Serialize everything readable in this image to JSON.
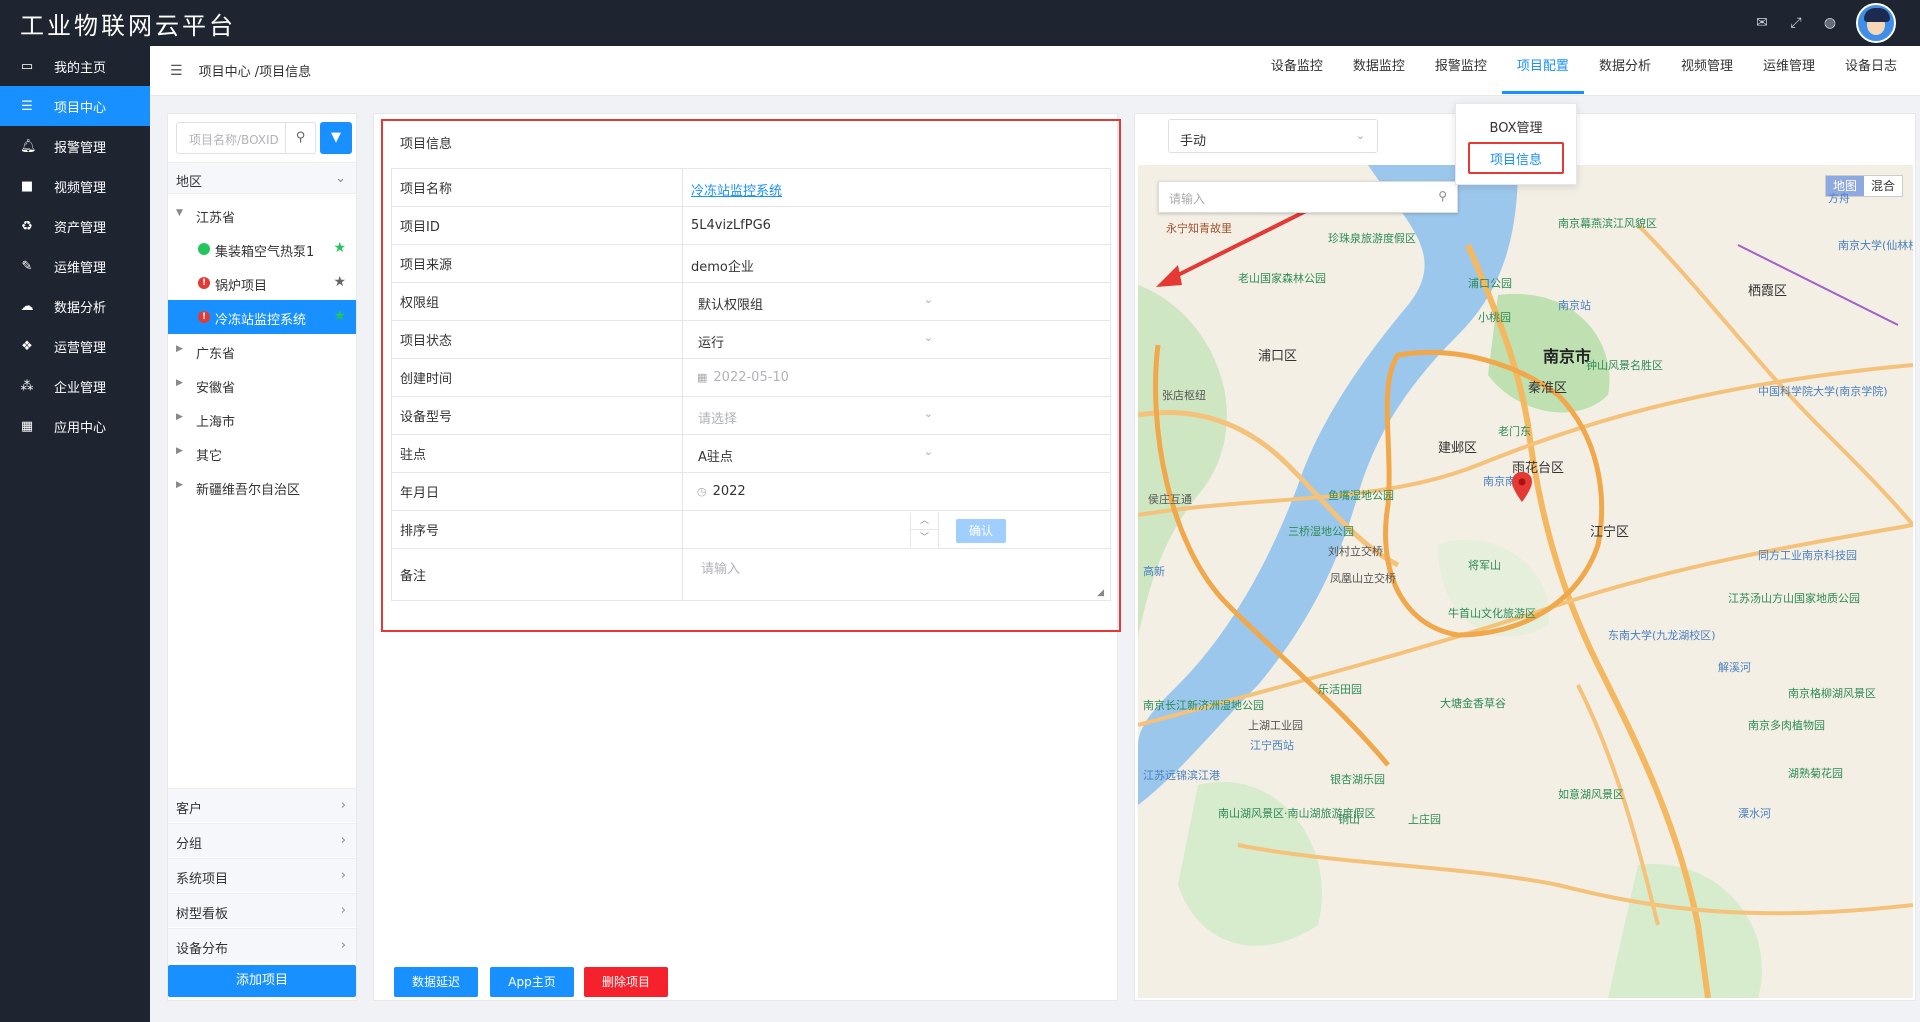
{
  "app": {
    "title": "工业物联网云平台"
  },
  "leftnav": {
    "items": [
      {
        "label": "我的主页",
        "icon": "laptop-icon",
        "active": false
      },
      {
        "label": "项目中心",
        "icon": "list-icon",
        "active": true
      },
      {
        "label": "报警管理",
        "icon": "bell-icon",
        "active": false
      },
      {
        "label": "视频管理",
        "icon": "video-icon",
        "active": false
      },
      {
        "label": "资产管理",
        "icon": "recycle-icon",
        "active": false
      },
      {
        "label": "运维管理",
        "icon": "wrench-icon",
        "active": false
      },
      {
        "label": "数据分析",
        "icon": "cloud-icon",
        "active": false
      },
      {
        "label": "运营管理",
        "icon": "cubes-icon",
        "active": false
      },
      {
        "label": "企业管理",
        "icon": "sitemap-icon",
        "active": false
      },
      {
        "label": "应用中心",
        "icon": "grid-icon",
        "active": false
      }
    ]
  },
  "header": {
    "breadcrumb": "项目中心 /项目信息",
    "tabs": [
      "设备监控",
      "数据监控",
      "报警监控",
      "项目配置",
      "数据分析",
      "视频管理",
      "运维管理",
      "设备日志"
    ],
    "active_tab": "项目配置"
  },
  "dropdown": {
    "items": [
      "BOX管理",
      "项目信息"
    ],
    "selected": "项目信息"
  },
  "tree": {
    "search_placeholder": "项目名称/BOXID",
    "region_header": "地区",
    "provinces": [
      "江苏省",
      "广东省",
      "安徽省",
      "上海市",
      "其它",
      "新疆维吾尔自治区"
    ],
    "projects": [
      {
        "name": "集装箱空气热泵1",
        "status": "online",
        "starred": true
      },
      {
        "name": "锅炉项目",
        "status": "alarm",
        "starred": false
      },
      {
        "name": "冷冻站监控系统",
        "status": "alarm",
        "starred": true,
        "selected": true
      }
    ],
    "sections": [
      "客户",
      "分组",
      "系统项目",
      "树型看板",
      "设备分布"
    ],
    "add_button": "添加项目"
  },
  "form": {
    "title": "项目信息",
    "labels": {
      "name": "项目名称",
      "id": "项目ID",
      "source": "项目来源",
      "perm": "权限组",
      "status": "项目状态",
      "created": "创建时间",
      "model": "设备型号",
      "site": "驻点",
      "year": "年月日",
      "order": "排序号",
      "remark": "备注"
    },
    "values": {
      "name": "冷冻站监控系统",
      "id": "5L4vizLfPG6",
      "source": "demo企业",
      "perm": "默认权限组",
      "status": "运行",
      "created": "2022-05-10",
      "model_placeholder": "请选择",
      "site": "A驻点",
      "year": "2022",
      "remark_placeholder": "请输入"
    },
    "confirm_label": "确认",
    "buttons": {
      "delay": "数据延迟",
      "app": "App主页",
      "delete": "删除项目"
    }
  },
  "map": {
    "mode": "手动",
    "search_placeholder": "请输入",
    "type_buttons": [
      "地图",
      "混合"
    ],
    "labels": {
      "city": "南京市",
      "qinhuai": "秦淮区",
      "pukou": "浦口区",
      "jianye": "建邺区",
      "yuhuatai": "雨花台区",
      "jiangning": "江宁区",
      "qixia": "栖霞区",
      "zhongshan": "钟山风景名胜区",
      "laomendong": "老门东",
      "sanqiao": "三桥湿地公园",
      "yuzui": "鱼嘴湿地公园",
      "niushou": "牛首山文化旅游区",
      "jiangjunshan": "将军山",
      "jiangsu_tangshan": "江苏汤山方山国家地质公园",
      "laoshan": "老山国家森林公园",
      "zhenzhuquan": "珍珠泉旅游度假区",
      "muyan": "南京幕燕滨江风貌区",
      "nanjing_station": "南京站",
      "xiaotaoyuan": "小桃园",
      "pukou_park": "浦口公园",
      "zhangdian": "张店枢纽",
      "houzhuang": "侯庄互通",
      "liucun": "刘村立交桥",
      "fenghuangshan": "凤凰山立交桥",
      "letian": "乐活田园",
      "datang": "大塘金香草谷",
      "jiangning_west": "江宁西站",
      "yinghu": "银杏湖乐园",
      "tongshan": "铜山",
      "shangzhuang": "上庄园",
      "rushi": "如意湖风景区",
      "nanshan_lake": "南山湖风景区·南山湖旅游度假区",
      "dongnan_univ": "东南大学(九龙湖校区)",
      "keda": "中国科学院大学(南京学院)",
      "tongfang": "同方工业南京科技园",
      "nanjing_rou": "南京多肉植物园",
      "gelin": "南京格柳湖风景区",
      "hushu": "湖熟菊花园",
      "yongning": "永宁知青故里",
      "nanjing_univ": "南京大学(仙林校区)",
      "fangzhou": "方舟",
      "gaoxin": "高新",
      "jiangsu_port": "江苏远锦滨江港",
      "nanjing_changjiang": "南京长江新济洲湿地公园",
      "shangyi": "上湖工业园",
      "jiedao": "解溪河",
      "lishui": "溧水河",
      "xinan": "南京南站"
    }
  },
  "colors": {
    "nav_bg": "#1e2430",
    "accent": "#1890ff",
    "danger": "#f5222d",
    "highlight_border": "#e53935",
    "confirm_disabled": "#a0cfff"
  }
}
